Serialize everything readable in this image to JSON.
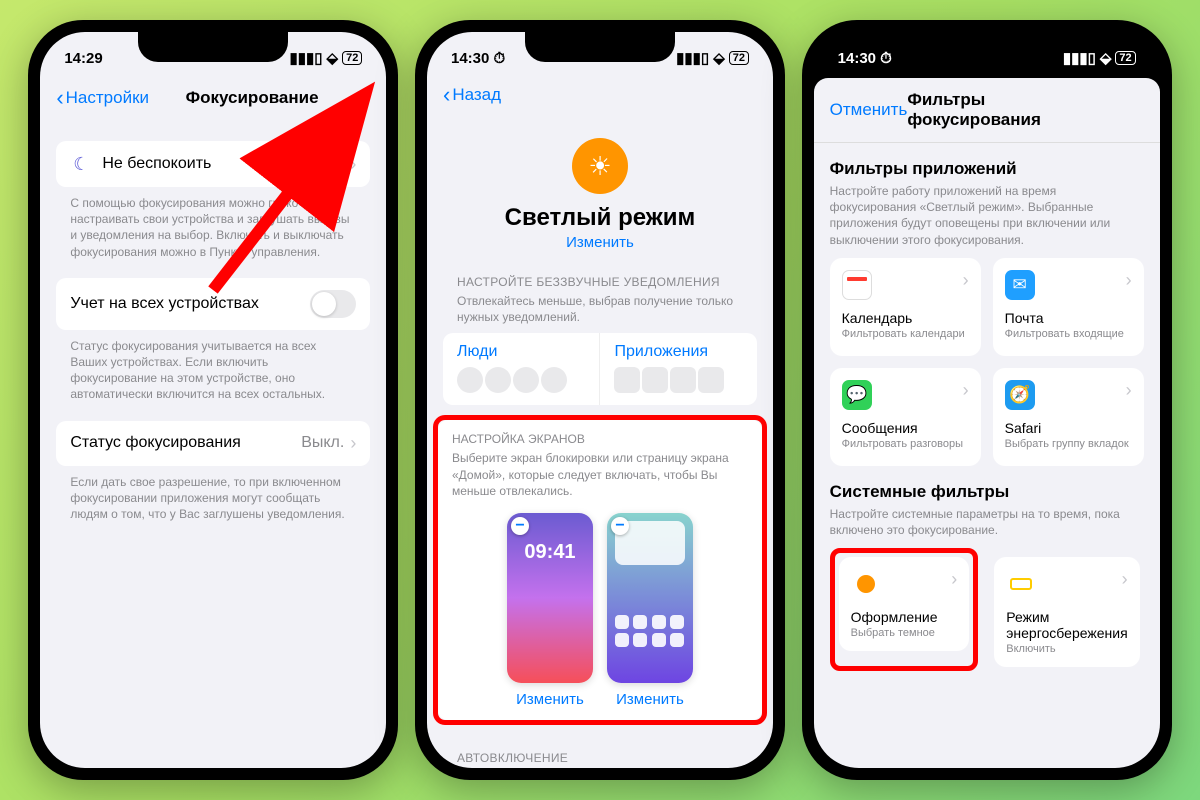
{
  "phone1": {
    "time": "14:29",
    "battery": "72",
    "nav": {
      "back": "Настройки",
      "title": "Фокусирование",
      "add": "+"
    },
    "dnd": "Не беспокоить",
    "dnd_footer": "С помощью фокусирования можно гибко настраивать свои устройства и заглушать вызовы и уведомления на выбор. Включать и выключать фокусирования можно в Пункте управления.",
    "share": "Учет на всех устройствах",
    "share_footer": "Статус фокусирования учитывается на всех Ваших устройствах. Если включить фокусирование на этом устройстве, оно автоматически включится на всех остальных.",
    "status": "Статус фокусирования",
    "status_value": "Выкл.",
    "status_footer": "Если дать свое разрешение, то при включенном фокусировании приложения могут сообщать людям о том, что у Вас заглушены уведомления."
  },
  "phone2": {
    "time": "14:30",
    "battery": "72",
    "nav": {
      "back": "Назад"
    },
    "focus_name": "Светлый режим",
    "change": "Изменить",
    "notif_header": "НАСТРОЙТЕ БЕЗЗВУЧНЫЕ УВЕДОМЛЕНИЯ",
    "notif_sub": "Отвлекайтесь меньше, выбрав получение только нужных уведомлений.",
    "people": "Люди",
    "apps": "Приложения",
    "screens_header": "НАСТРОЙКА ЭКРАНОВ",
    "screens_sub": "Выберите экран блокировки или страницу экрана «Домой», которые следует включать, чтобы Вы меньше отвлекались.",
    "preview_time": "09:41",
    "edit": "Изменить",
    "auto": "АВТОВКЛЮЧЕНИЕ"
  },
  "phone3": {
    "time": "14:30",
    "battery": "72",
    "cancel": "Отменить",
    "title": "Фильтры фокусирования",
    "apps_title": "Фильтры приложений",
    "apps_desc": "Настройте работу приложений на время фокусирования «Светлый режим». Выбранные приложения будут оповещены при включении или выключении этого фокусирования.",
    "filters": [
      {
        "name": "Календарь",
        "sub": "Фильтровать календари"
      },
      {
        "name": "Почта",
        "sub": "Фильтровать входящие"
      },
      {
        "name": "Сообщения",
        "sub": "Фильтровать разговоры"
      },
      {
        "name": "Safari",
        "sub": "Выбрать группу вкладок"
      }
    ],
    "sys_title": "Системные фильтры",
    "sys_desc": "Настройте системные параметры на то время, пока включено это фокусирование.",
    "sys_filters": [
      {
        "name": "Оформление",
        "sub": "Выбрать темное"
      },
      {
        "name": "Режим энергосбережения",
        "sub": "Включить"
      }
    ]
  }
}
